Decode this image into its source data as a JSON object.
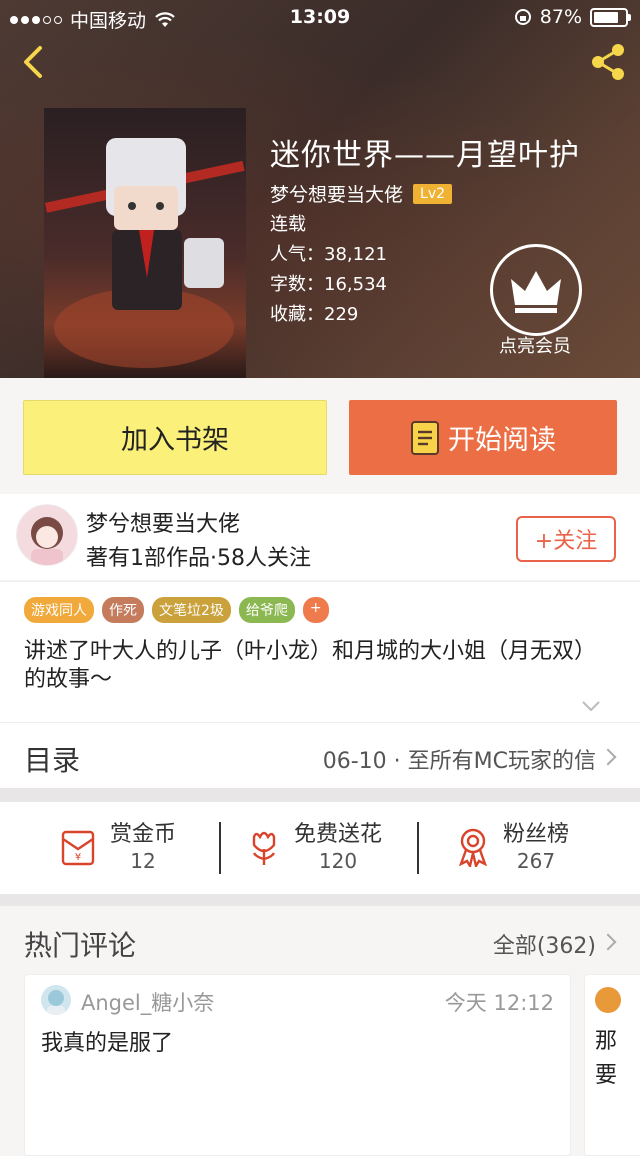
{
  "status_bar": {
    "carrier": "中国移动",
    "time": "13:09",
    "battery": "87%"
  },
  "book": {
    "title": "迷你世界——月望叶护",
    "author": "梦兮想要当大佬",
    "level": "Lv2",
    "status": "连载",
    "popularity_label": "人气：",
    "popularity": "38,121",
    "words_label": "字数：",
    "words": "16,534",
    "favorites_label": "收藏：",
    "favorites": "229",
    "vip_label": "点亮会员"
  },
  "actions": {
    "shelf_label": "加入书架",
    "read_label": "开始阅读"
  },
  "author_card": {
    "name": "梦兮想要当大佬",
    "info": "著有1部作品·58人关注",
    "follow_label": "+关注"
  },
  "tags": [
    {
      "label": "游戏同人",
      "color": "#f0a93a"
    },
    {
      "label": "作死",
      "color": "#c47c5c"
    },
    {
      "label": "文笔垃2圾",
      "color": "#caa13a"
    },
    {
      "label": "给爷爬",
      "color": "#8bb851"
    },
    {
      "label": "+",
      "color": "#ef7a4c"
    }
  ],
  "description": "讲述了叶大人的儿子（叶小龙）和月城的大小姐（月无双）的故事～",
  "toc": {
    "label": "目录",
    "latest": "06-10 · 至所有MC玩家的信"
  },
  "support": {
    "coins": {
      "label": "赏金币",
      "count": "12"
    },
    "flowers": {
      "label": "免费送花",
      "count": "120"
    },
    "fans": {
      "label": "粉丝榜",
      "count": "267"
    }
  },
  "comments": {
    "title": "热门评论",
    "all_label": "全部(362)",
    "items": [
      {
        "user": "Angel_糖小奈",
        "time": "今天 12:12",
        "text": "我真的是服了"
      },
      {
        "text": "那要"
      }
    ]
  },
  "colors": {
    "accent": "#ec6e44",
    "shelf": "#fbf07a",
    "follow": "#e8634a"
  }
}
